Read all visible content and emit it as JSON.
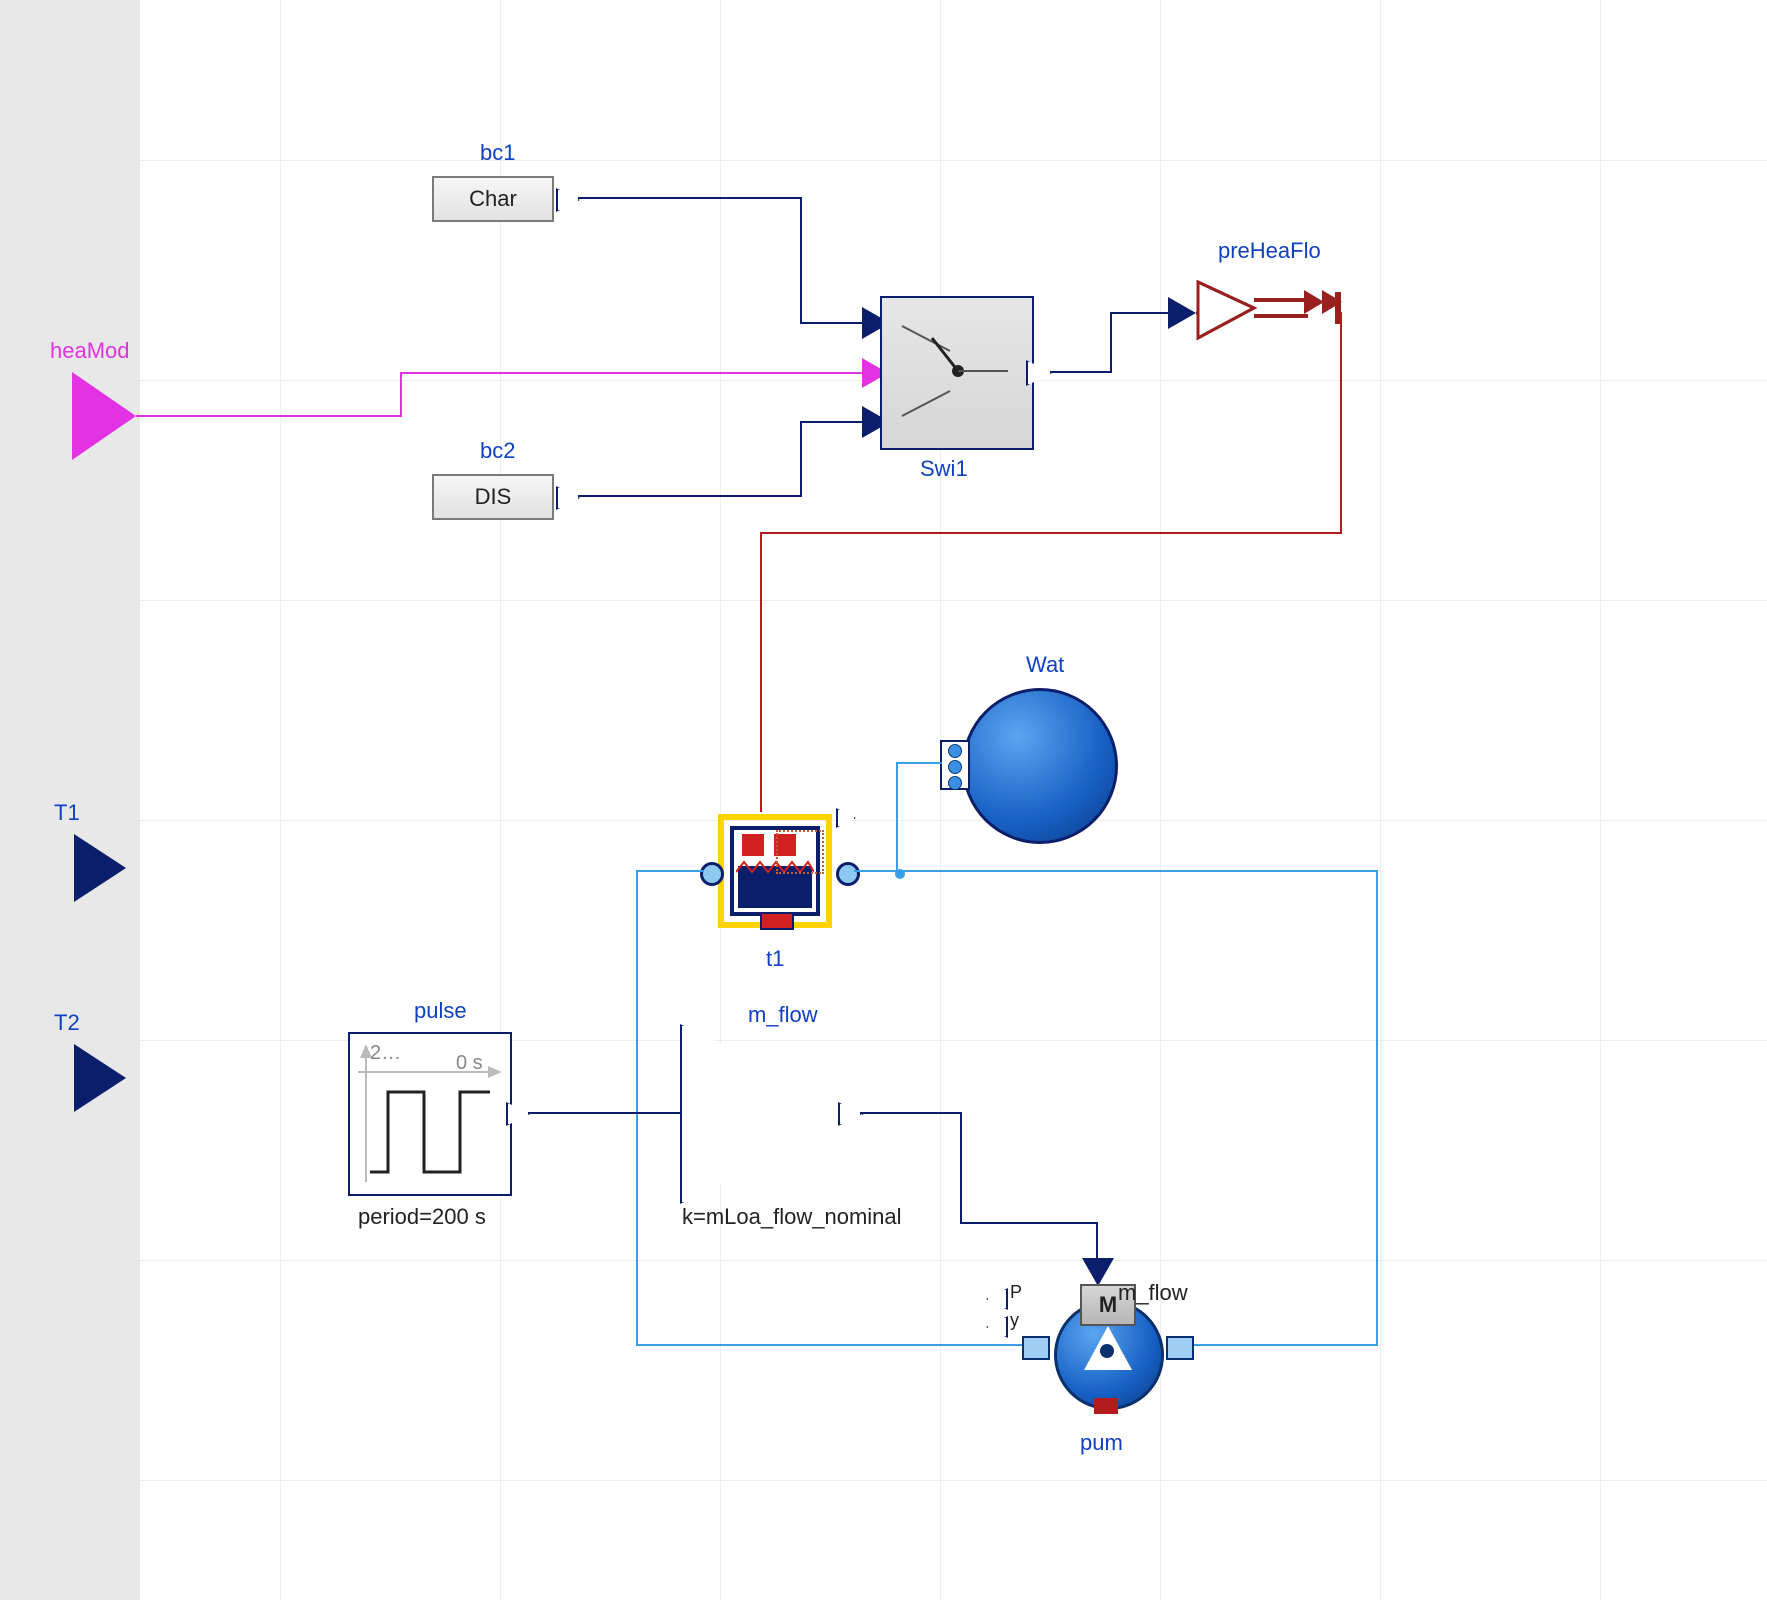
{
  "components": {
    "heaMod": {
      "label": "heaMod"
    },
    "bc1": {
      "label": "bc1",
      "text": "Char"
    },
    "bc2": {
      "label": "bc2",
      "text": "DIS"
    },
    "swi1": {
      "label": "Swi1"
    },
    "preHeaFlo": {
      "label": "preHeaFlo"
    },
    "wat": {
      "label": "Wat"
    },
    "t1": {
      "label": "t1"
    },
    "T1": {
      "label": "T1"
    },
    "T2": {
      "label": "T2"
    },
    "pulse": {
      "label": "pulse",
      "annotation_top": "2…",
      "annotation_right": "0 s",
      "caption": "period=200 s"
    },
    "m_flow_gain": {
      "label": "m_flow",
      "caption": "k=mLoa_flow_nominal"
    },
    "pum": {
      "label": "pum",
      "port_label_P": "P",
      "port_label_y": "y",
      "port_label_mflow": "m_flow",
      "motor": "M"
    }
  }
}
